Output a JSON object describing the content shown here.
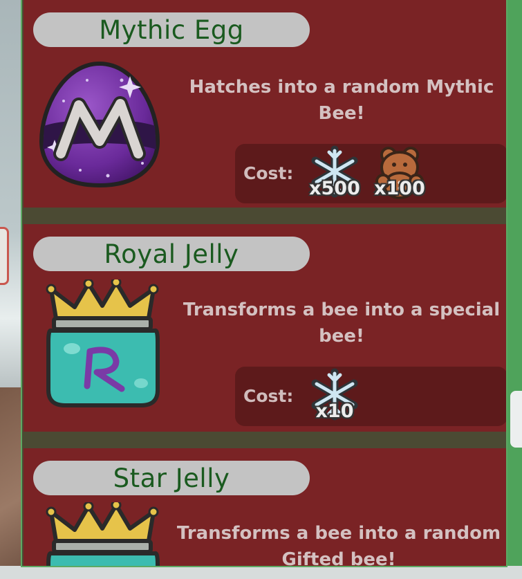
{
  "shop": {
    "items": [
      {
        "name": "Mythic Egg",
        "description_line1": "Hatches into a random Mythic",
        "description_line2": "Bee!",
        "cost_label": "Cost:",
        "costs": [
          {
            "currency_icon": "snowflake-icon",
            "quantity": "x500"
          },
          {
            "currency_icon": "gingerbread-bear-icon",
            "quantity": "x100"
          }
        ]
      },
      {
        "name": "Royal Jelly",
        "description_line1": "Transforms a bee into a special",
        "description_line2": "bee!",
        "cost_label": "Cost:",
        "costs": [
          {
            "currency_icon": "snowflake-icon",
            "quantity": "x10"
          }
        ]
      },
      {
        "name": "Star Jelly",
        "description_line1": "Transforms a bee into a random",
        "description_line2": "Gifted bee!"
      }
    ]
  },
  "colors": {
    "card_bg": "#7a2325",
    "cost_box_bg": "#5d1a1b",
    "title_text": "#1a5a1f",
    "panel_border": "#5da963"
  }
}
